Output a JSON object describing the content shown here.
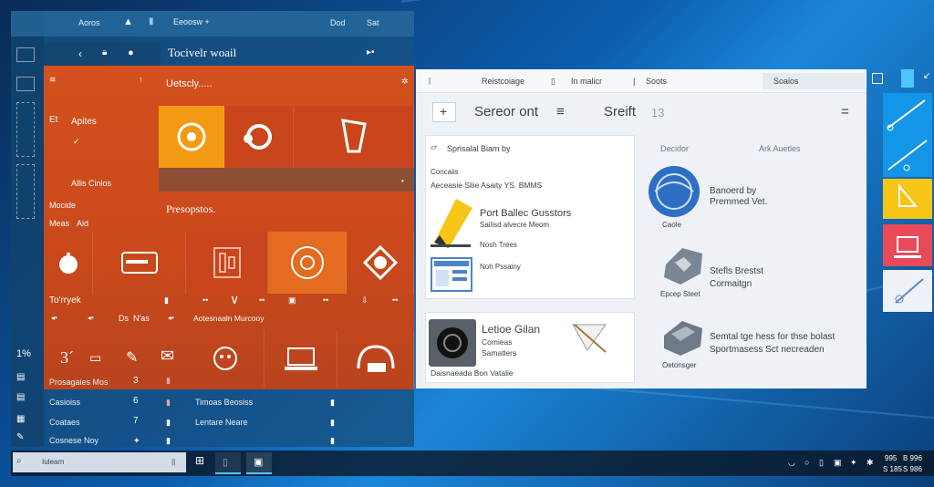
{
  "left_window": {
    "top": {
      "title": "Aoros",
      "app": "Eeoosw +",
      "right1": "Dod",
      "right2": "Sat"
    },
    "subheader": {
      "title": "Tocivelr woail"
    },
    "side_labels": {
      "s1": "Apites",
      "s2": "Allis Cinlos",
      "s3": "Mocide",
      "s4": "Meas",
      "s5": "Aid"
    },
    "number_big": "3´",
    "bottom_list": [
      {
        "label": "Prosagaies Mos",
        "num": "3"
      },
      {
        "label": "Casioiss",
        "num": "6"
      },
      {
        "label": "Coataes",
        "num": "7"
      },
      {
        "label": "Cosnese Noy",
        "num": ""
      }
    ],
    "bottom_mid": [
      "Timoas Beosiss",
      "Lentare Neare"
    ],
    "edge_numbers": {
      "n1": "1%"
    }
  },
  "orange_panel": {
    "header": "Uetscly.....",
    "section": "Presopstos.",
    "row_labels": {
      "r1": "To'rryek",
      "r2": "Aotesnaaln Murcooy"
    },
    "small_labels": {
      "l1": "Ds",
      "l2": "N'as"
    }
  },
  "center_window": {
    "toolbar": {
      "t1": "Reistcoiage",
      "t2": "In malicr",
      "t3": "Soots",
      "search": "Soaios"
    },
    "header": {
      "add": "+",
      "title": "Sereor ont",
      "menu_icon": "≡",
      "tab": "Sreift",
      "count": "13",
      "right_menu": "="
    },
    "card1": {
      "heading": "Sprisalal Biam by",
      "sub1": "Concaiis",
      "sub2": "Aeceasie Sliie Asaity YS. BMMS",
      "item_title": "Port Ballec Gusstors",
      "item_sub1": "Sailisd alvecre Meom",
      "item_sub2": "Nosh Trees",
      "item_sub3": "Noh Pssainy"
    },
    "card2": {
      "title": "Letioe Gilan",
      "sub1": "Comieas",
      "sub2": "Samatlers",
      "footer": "Daisnaeada Bon Vatalie"
    },
    "right_col": {
      "h1": "Decidor",
      "h2": "Ark Auetles",
      "item1_title": "Banoerd by",
      "item1_sub": "Premmed Vet.",
      "item1_caption": "Caole",
      "item2_title": "Stefls Brestst",
      "item2_sub": "Cormaitgn",
      "item2_caption": "Epcep Steet",
      "item3_title": "Semtal tge hess for thse bolast",
      "item3_sub": "Sportmasess Sct necreaden",
      "item3_caption": "Oetonsger"
    }
  },
  "taskbar": {
    "search": "Iulearn",
    "clock1": "995",
    "clock2": "B 996",
    "clock3": "S 185",
    "clock4": "S 986"
  },
  "colors": {
    "orange": "#d4501e",
    "blue_panel": "#1b5a8c",
    "yellow_tile": "#f5c518",
    "red_tile": "#e84a5a",
    "cyan_tile": "#1396e8"
  }
}
